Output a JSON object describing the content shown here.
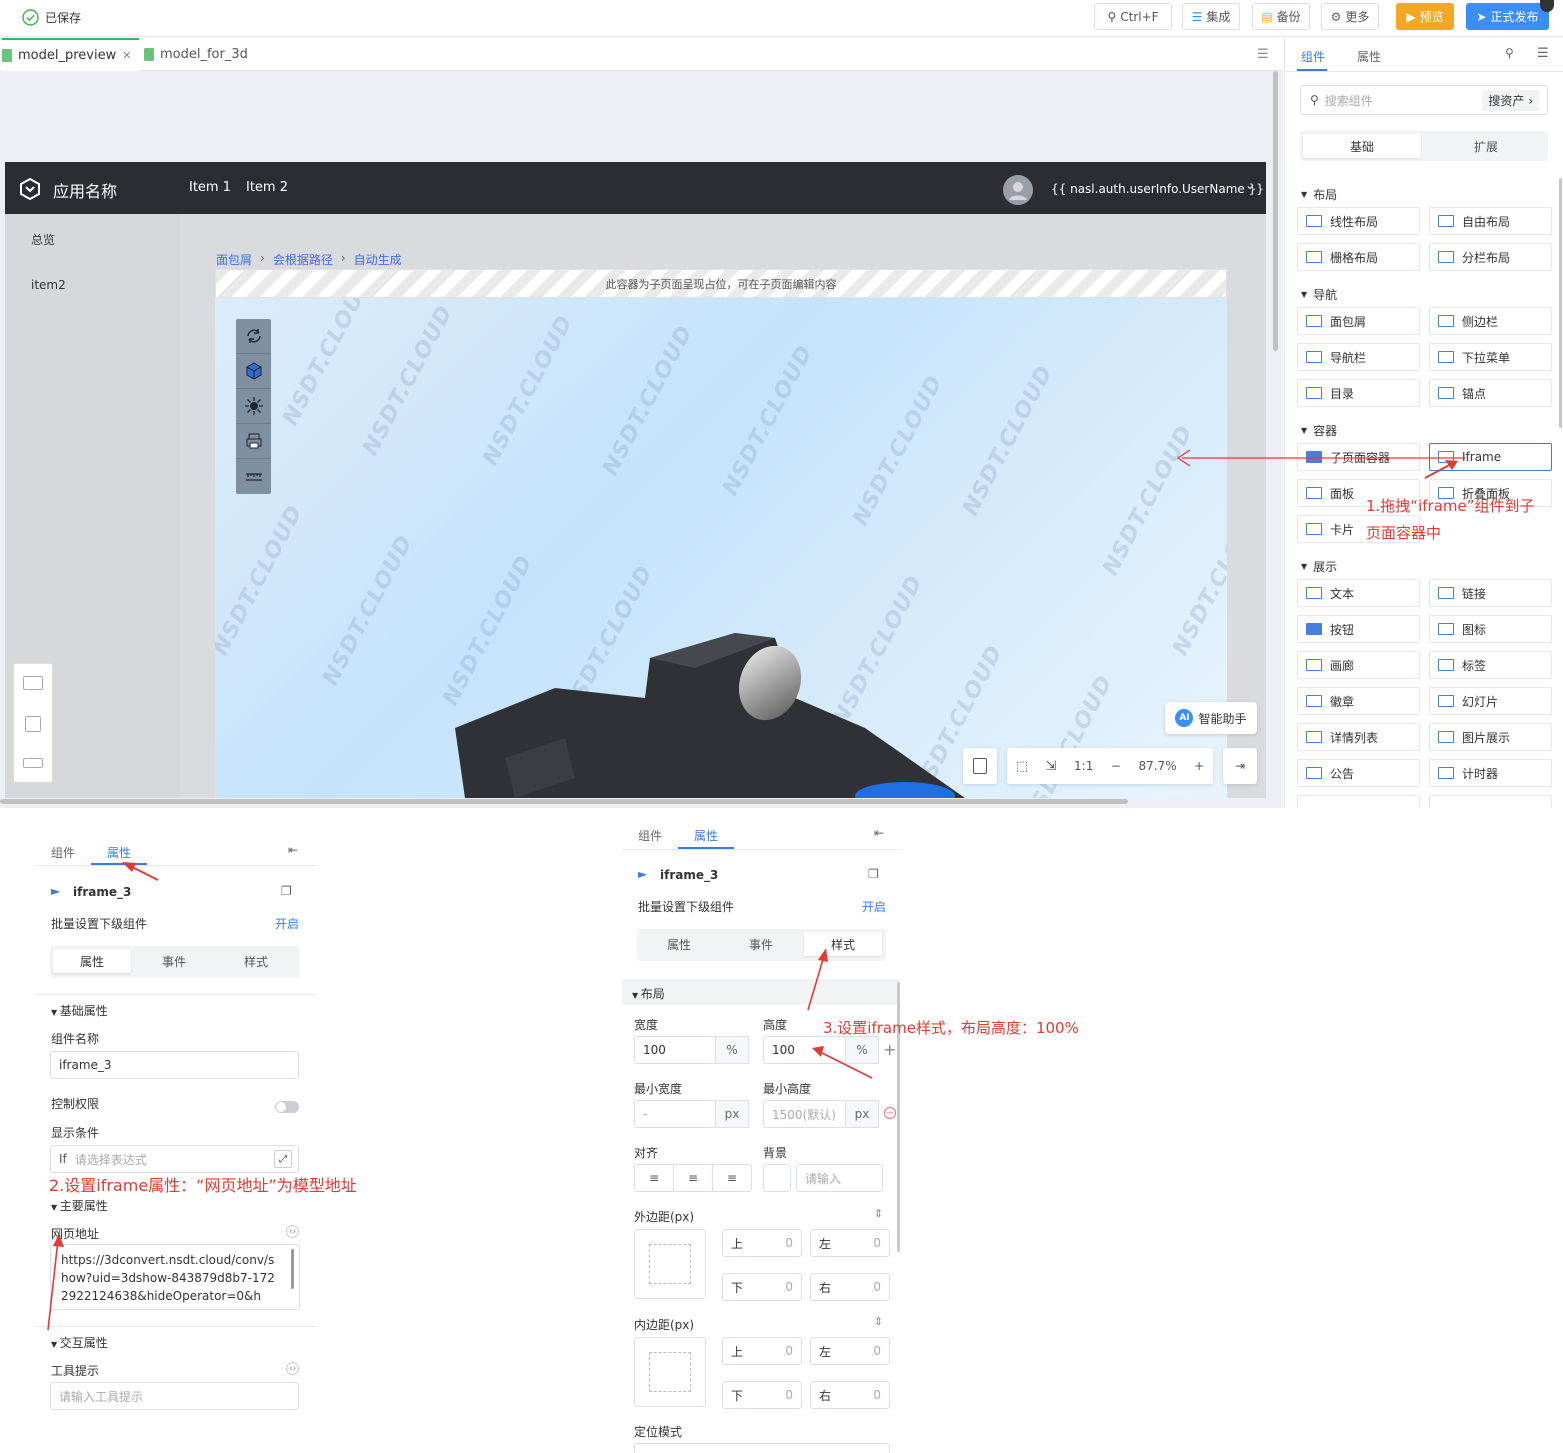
{
  "topbar": {
    "saved": "已保存",
    "search_shortcut": "Ctrl+F",
    "integrate": "集成",
    "backup": "备份",
    "more": "更多",
    "preview": "预览",
    "publish": "正式发布"
  },
  "file_tabs": [
    "model_preview",
    "model_for_3d"
  ],
  "app": {
    "name": "应用名称",
    "nav": [
      "Item 1",
      "Item 2"
    ],
    "user": "{{ nasl.auth.userInfo.UserName }}",
    "sidebar": [
      "总览",
      "item2"
    ],
    "breadcrumb": [
      "面包屑",
      "会根据路径",
      "自动生成"
    ],
    "placeholder_note": "此容器为子页面呈现占位，可在子页面编辑内容",
    "watermark": "NSDT.CLOUD",
    "ai_helper": "智能助手",
    "ai_badge": "AI",
    "zoom_ratio": "1:1",
    "zoom": "87.7%"
  },
  "right_panel": {
    "tabs": [
      "组件",
      "属性"
    ],
    "search_placeholder": "搜索组件",
    "search_assets": "搜资产",
    "segments": [
      "基础",
      "扩展"
    ],
    "sections": [
      {
        "title": "布局",
        "items": [
          "线性布局",
          "自由布局",
          "栅格布局",
          "分栏布局"
        ]
      },
      {
        "title": "导航",
        "items": [
          "面包屑",
          "侧边栏",
          "导航栏",
          "下拉菜单",
          "目录",
          "锚点"
        ]
      },
      {
        "title": "容器",
        "items": [
          "子页面容器",
          "Iframe",
          "面板",
          "折叠面板",
          "卡片"
        ]
      },
      {
        "title": "展示",
        "items": [
          "文本",
          "链接",
          "按钮",
          "图标",
          "画廊",
          "标签",
          "徽章",
          "幻灯片",
          "详情列表",
          "图片展示",
          "公告",
          "计时器"
        ]
      }
    ]
  },
  "annotations": {
    "step1_line1": "1.拖拽“iframe”组件到子",
    "step1_line2": "页面容器中",
    "step2": "2.设置iframe属性：“网页地址”为模型地址",
    "step3": "3.设置iframe样式，布局高度：100%"
  },
  "props_left": {
    "tabs": [
      "组件",
      "属性"
    ],
    "component_name": "iframe_3",
    "batch_label": "批量设置下级组件",
    "batch_action": "开启",
    "segments": [
      "属性",
      "事件",
      "样式"
    ],
    "basic_title": "基础属性",
    "name_label": "组件名称",
    "name_value": "iframe_3",
    "permission_label": "控制权限",
    "condition_label": "显示条件",
    "condition_prefix": "If",
    "condition_placeholder": "请选择表达式",
    "main_title": "主要属性",
    "url_label": "网页地址",
    "url_value": "https://3dconvert.nsdt.cloud/conv/show?uid=3dshow-843879d8b7-1722922124638&hideOperator=0&h",
    "interact_title": "交互属性",
    "tooltip_label": "工具提示",
    "tooltip_placeholder": "请输入工具提示"
  },
  "props_right": {
    "tabs": [
      "组件",
      "属性"
    ],
    "component_name": "iframe_3",
    "batch_label": "批量设置下级组件",
    "batch_action": "开启",
    "segments": [
      "属性",
      "事件",
      "样式"
    ],
    "layout_title": "布局",
    "width_label": "宽度",
    "width_value": "100",
    "height_label": "高度",
    "height_value": "100",
    "unit_percent": "%",
    "min_width_label": "最小宽度",
    "min_width_value": "-",
    "min_height_label": "最小高度",
    "min_height_value": "1500(默认)",
    "unit_px": "px",
    "align_label": "对齐",
    "bg_label": "背景",
    "bg_placeholder": "请输入",
    "margin_label": "外边距(px)",
    "padding_label": "内边距(px)",
    "dir_top": "上",
    "dir_left": "左",
    "dir_bottom": "下",
    "dir_right": "右",
    "zero": "0",
    "position_label": "定位模式"
  }
}
